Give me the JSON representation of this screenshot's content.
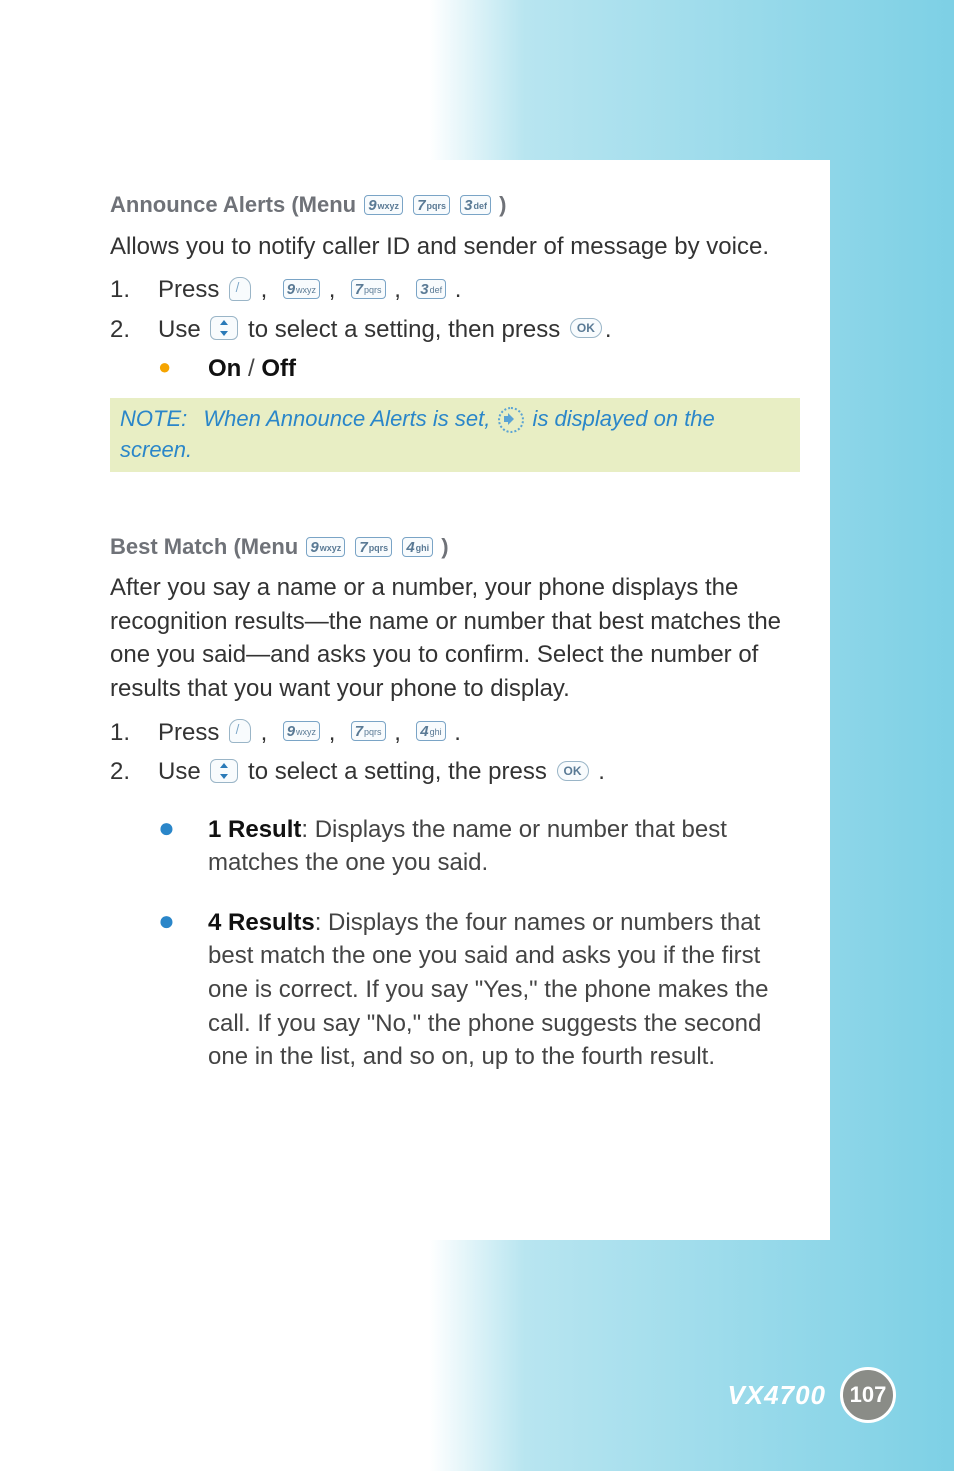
{
  "section1": {
    "title_prefix": "Announce Alerts (Menu ",
    "title_suffix": ")",
    "keys": [
      {
        "big": "9",
        "sub": "wxyz"
      },
      {
        "big": "7",
        "sub": "pqrs"
      },
      {
        "big": "3",
        "sub": "def"
      }
    ],
    "intro": "Allows you to notify caller ID and sender of message by voice.",
    "step1_num": "1.",
    "step1_text_a": "Press ",
    "step1_keys": [
      {
        "big": "9",
        "sub": "wxyz"
      },
      {
        "big": "7",
        "sub": "pqrs"
      },
      {
        "big": "3",
        "sub": "def"
      }
    ],
    "step2_num": "2.",
    "step2_text_a": "Use ",
    "step2_text_b": " to select a setting, then press ",
    "step2_text_c": ".",
    "ok_label": "OK",
    "bullet_label": "On / Off",
    "bullet_on": "On",
    "bullet_sep": " / ",
    "bullet_off": "Off",
    "note_label": "NOTE:",
    "note_text_a": "When Announce Alerts is set, ",
    "note_text_b": " is displayed on the screen."
  },
  "section2": {
    "title_prefix": "Best Match (Menu ",
    "title_suffix": ")",
    "keys": [
      {
        "big": "9",
        "sub": "wxyz"
      },
      {
        "big": "7",
        "sub": "pqrs"
      },
      {
        "big": "4",
        "sub": "ghi"
      }
    ],
    "intro": "After you say a name or a number, your phone displays the recognition results—the name or number that best matches the one you said—and asks you to confirm. Select the number of results that you want your phone to display.",
    "step1_num": "1.",
    "step1_text_a": "Press ",
    "step1_keys": [
      {
        "big": "9",
        "sub": "wxyz"
      },
      {
        "big": "7",
        "sub": "pqrs"
      },
      {
        "big": "4",
        "sub": "ghi"
      }
    ],
    "step2_num": "2.",
    "step2_text_a": "Use ",
    "step2_text_b": " to select a setting, the press  ",
    "step2_text_c": " .",
    "ok_label": "OK",
    "result1_bold": "1 Result",
    "result1_text": ": Displays the name or number that best matches the one you said.",
    "result4_bold": "4 Results",
    "result4_text": ": Displays the four names or numbers that best match the one you said and asks you if the first one is correct. If you say \"Yes,\" the phone makes the call. If you say \"No,\" the phone suggests the second one in the list, and so on, up to the fourth result."
  },
  "footer": {
    "model": "VX4700",
    "page": "107"
  }
}
